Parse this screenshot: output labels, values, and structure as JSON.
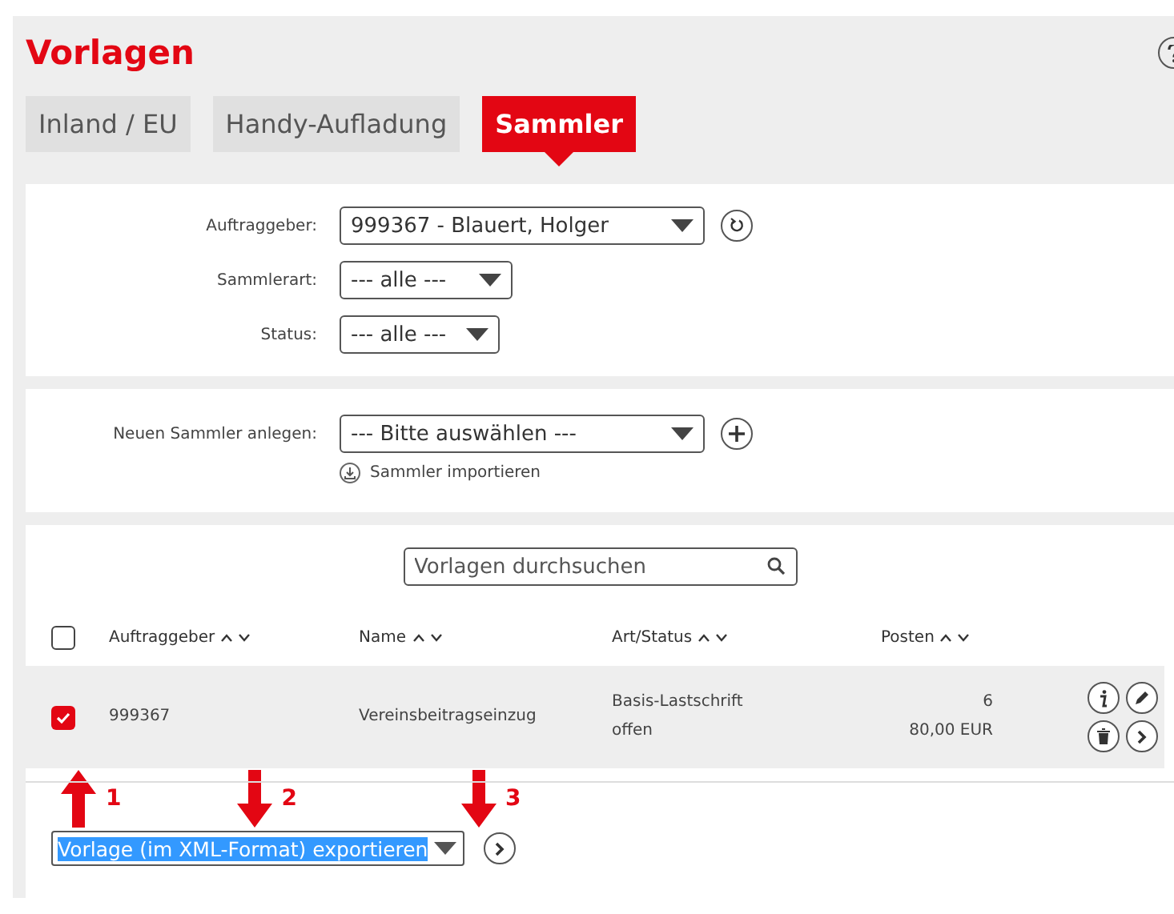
{
  "title": "Vorlagen",
  "tabs": [
    {
      "label": "Inland / EU",
      "selected": false
    },
    {
      "label": "Handy-Aufladung",
      "selected": false
    },
    {
      "label": "Sammler",
      "selected": true
    }
  ],
  "filters": [
    {
      "label": "Auftraggeber:",
      "value": "999367 - Blauert, Holger",
      "refresh": true
    },
    {
      "label": "Sammlerart:",
      "value": "--- alle ---",
      "refresh": false
    },
    {
      "label": "Status:",
      "value": "--- alle ---",
      "refresh": false
    }
  ],
  "create": {
    "label": "Neuen Sammler anlegen:",
    "value": "--- Bitte auswählen ---",
    "import_link": "Sammler importieren"
  },
  "search": {
    "placeholder": "Vorlagen durchsuchen"
  },
  "table": {
    "select_all_checked": false,
    "columns": [
      "Auftraggeber",
      "Name",
      "Art/Status",
      "Posten"
    ],
    "rows": [
      {
        "checked": true,
        "auftraggeber": "999367",
        "name": "Vereinsbeitragseinzug",
        "art": "Basis-Lastschrift",
        "status": "offen",
        "posten": "6",
        "betrag": "80,00 EUR"
      }
    ]
  },
  "bulk_action": {
    "value": "Vorlage (im XML-Format) exportieren",
    "highlighted": true
  },
  "annotations": [
    {
      "number": "1",
      "kind": "up"
    },
    {
      "number": "2",
      "kind": "down"
    },
    {
      "number": "3",
      "kind": "down"
    }
  ]
}
